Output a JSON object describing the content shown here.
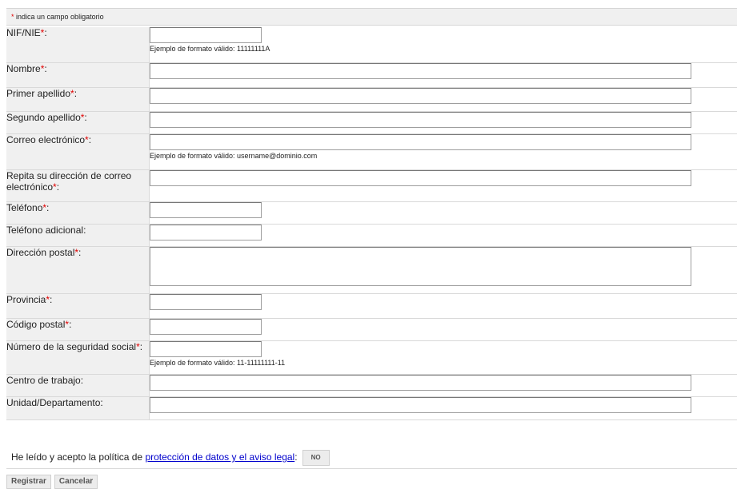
{
  "required_note": {
    "asterisk": "*",
    "text": " indica un campo obligatorio"
  },
  "asterisk": "*",
  "fields": {
    "nif": {
      "label": "NIF/NIE",
      "value": "",
      "hint": "Ejemplo de formato válido: 11111111A"
    },
    "nombre": {
      "label": "Nombre",
      "value": ""
    },
    "apellido1": {
      "label": "Primer apellido",
      "value": ""
    },
    "apellido2": {
      "label": "Segundo apellido",
      "value": ""
    },
    "email": {
      "label": "Correo electrónico",
      "value": "",
      "hint": "Ejemplo de formato válido: username@dominio.com"
    },
    "email_repeat": {
      "label": "Repita su dirección de correo electrónico",
      "value": ""
    },
    "telefono": {
      "label": "Teléfono",
      "value": ""
    },
    "telefono_adicional": {
      "label": "Teléfono adicional:",
      "value": ""
    },
    "direccion": {
      "label": "Dirección postal",
      "value": ""
    },
    "provincia": {
      "label": "Provincia",
      "value": ""
    },
    "codigo_postal": {
      "label": "Código postal",
      "value": ""
    },
    "nss": {
      "label": "Número de la seguridad social",
      "value": "",
      "hint": "Ejemplo de formato válido: 11-11111111-11"
    },
    "centro": {
      "label": "Centro de trabajo:",
      "value": ""
    },
    "unidad": {
      "label": "Unidad/Departamento:",
      "value": ""
    }
  },
  "acceptance": {
    "prefix": "He leído y acepto la política de ",
    "link_text": "protección de datos y el aviso legal",
    "suffix": ":",
    "toggle_label": "NO"
  },
  "buttons": {
    "register": "Registrar",
    "cancel": "Cancelar"
  }
}
